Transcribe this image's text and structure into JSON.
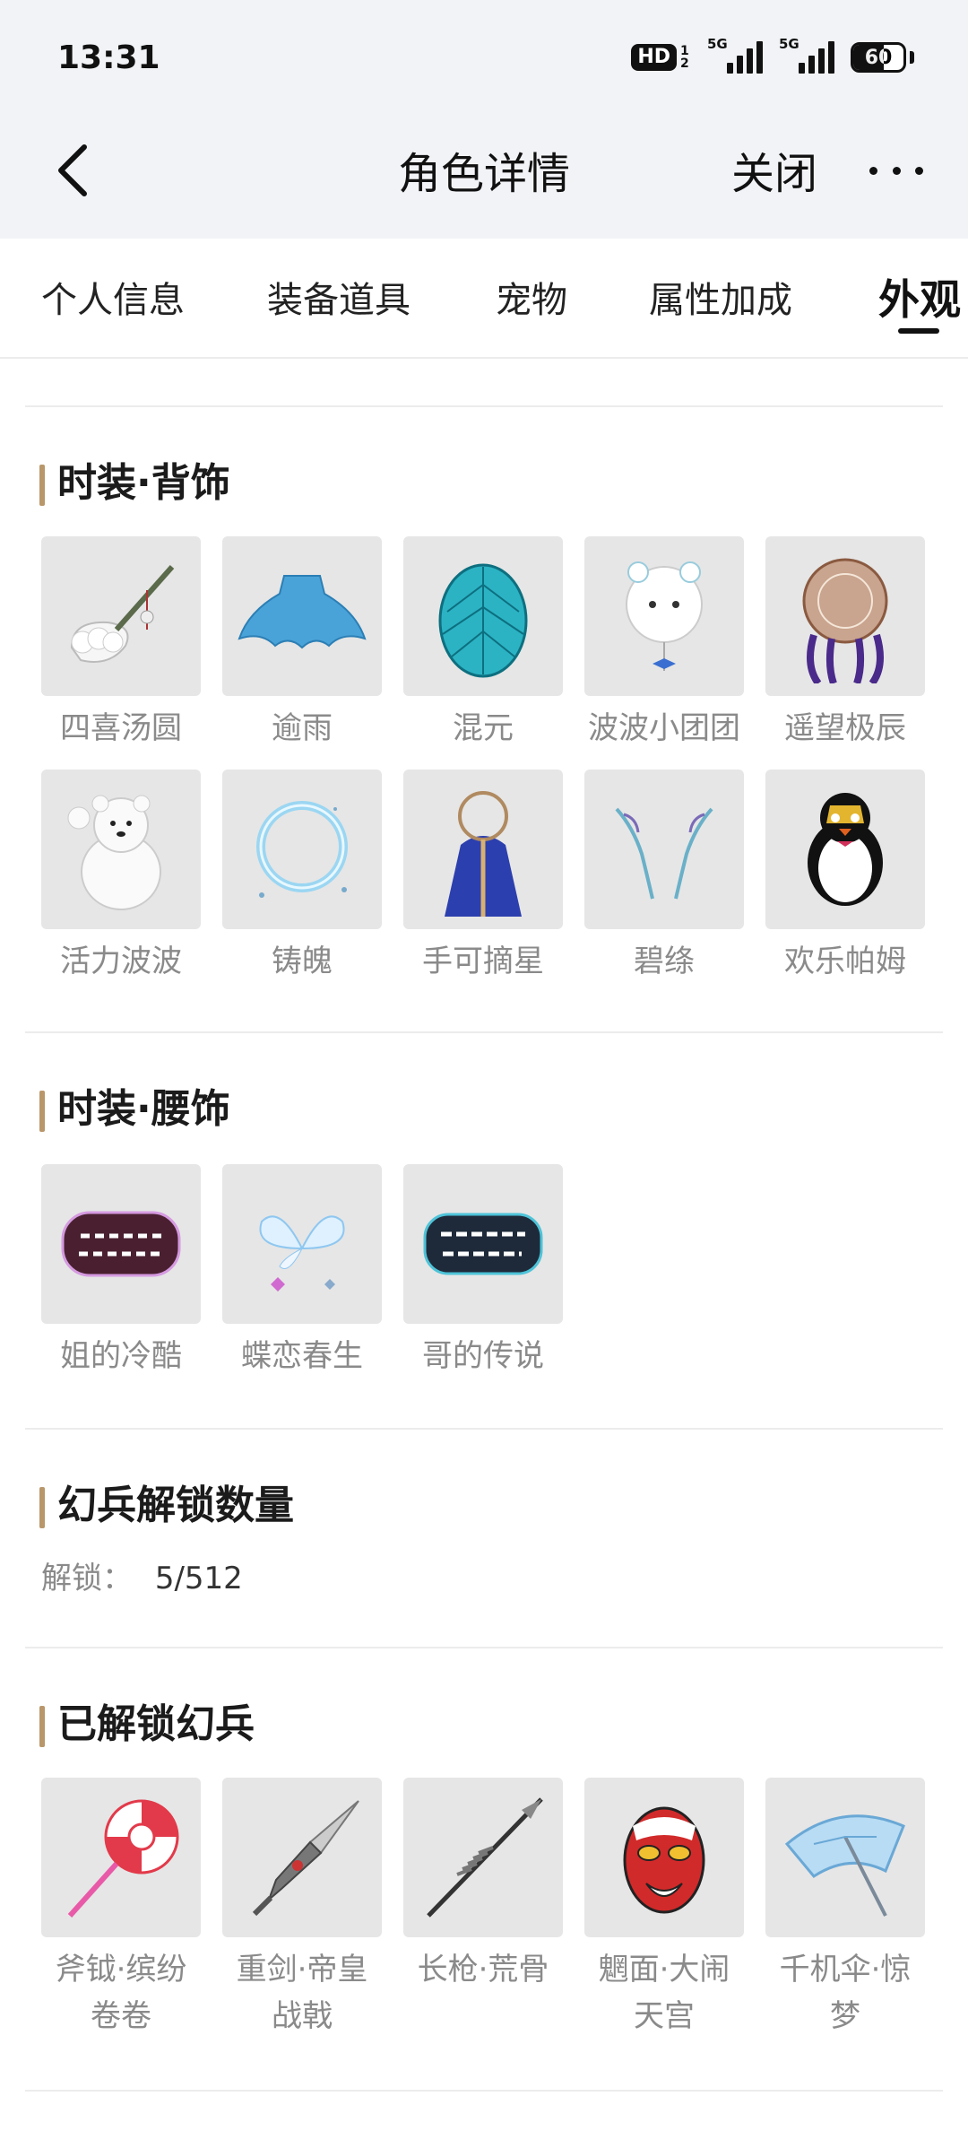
{
  "status": {
    "time": "13:31",
    "hd": "HD",
    "hd_sub": "1 2",
    "net1": "5G",
    "net2": "5G",
    "battery": "60",
    "battery_level": 0.6
  },
  "nav": {
    "title": "角色详情",
    "close": "关闭"
  },
  "tabs": [
    "个人信息",
    "装备道具",
    "宠物",
    "属性加成",
    "外观"
  ],
  "active_tab": "外观",
  "sections": {
    "back_ornament": {
      "title": "时装·背饰",
      "items": [
        {
          "label": "四喜汤圆",
          "icon": "rice-ball-spoon-icon"
        },
        {
          "label": "逾雨",
          "icon": "blue-cape-icon"
        },
        {
          "label": "混元",
          "icon": "crystal-egg-icon"
        },
        {
          "label": "波波小团团",
          "icon": "bear-balloon-icon"
        },
        {
          "label": "遥望极辰",
          "icon": "star-disc-icon"
        },
        {
          "label": "活力波波",
          "icon": "polar-bear-icon"
        },
        {
          "label": "铸魄",
          "icon": "light-ring-icon"
        },
        {
          "label": "手可摘星",
          "icon": "star-staff-icon"
        },
        {
          "label": "碧绦",
          "icon": "ribbon-wings-icon"
        },
        {
          "label": "欢乐帕姆",
          "icon": "penguin-icon"
        }
      ]
    },
    "waist_ornament": {
      "title": "时装·腰饰",
      "items": [
        {
          "label": "姐的冷酷",
          "icon": "neon-text-badge-icon"
        },
        {
          "label": "蝶恋春生",
          "icon": "butterfly-icon"
        },
        {
          "label": "哥的传说",
          "icon": "neon-legend-badge-icon"
        }
      ]
    },
    "phantom_count": {
      "title": "幻兵解锁数量",
      "key": "解锁：",
      "value": "5/512"
    },
    "unlocked_phantom": {
      "title": "已解锁幻兵",
      "items": [
        {
          "label": "斧钺·缤纷卷卷",
          "icon": "lollipop-axe-icon"
        },
        {
          "label": "重剑·帝皇战戟",
          "icon": "great-sword-icon"
        },
        {
          "label": "长枪·荒骨",
          "icon": "bone-spear-icon"
        },
        {
          "label": "魍面·大闹天宫",
          "icon": "monkey-mask-icon"
        },
        {
          "label": "千机伞·惊梦",
          "icon": "blue-umbrella-icon"
        }
      ]
    }
  }
}
